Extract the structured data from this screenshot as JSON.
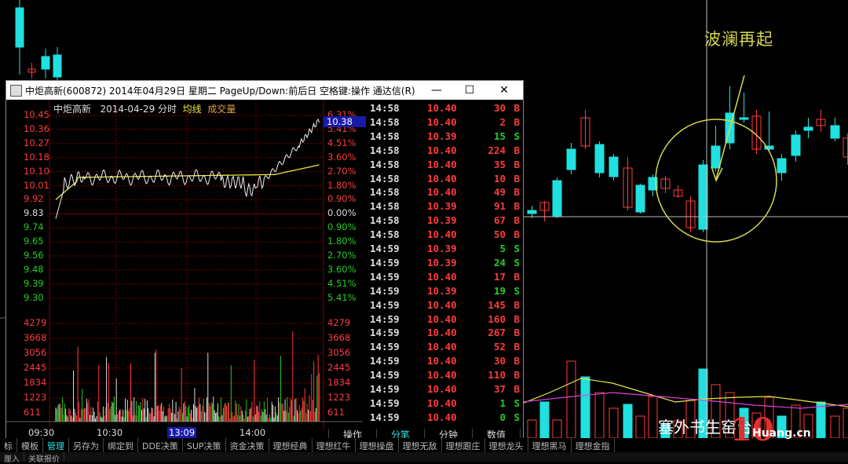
{
  "annotation": "波澜再起",
  "window": {
    "title": "中炬高新(600872) 2014年04月29日 星期二 PageUp/Down:前后日 空格键:操作 通达信(R)",
    "minimize": "—",
    "maximize": "☐",
    "close": "✕"
  },
  "chart_header": {
    "name": "中炬高新",
    "date": "2014-04-29 分时",
    "avg_label": "均线",
    "vol_label": "成交量"
  },
  "current_price_box": "10.38",
  "price_axis_left": [
    "10.45",
    "10.36",
    "10.27",
    "10.18",
    "10.10",
    "10.01",
    "9.92",
    "9.83",
    "9.74",
    "9.65",
    "9.56",
    "9.48",
    "9.39",
    "9.30"
  ],
  "pct_axis_right": [
    "6.31%",
    "5.41%",
    "4.51%",
    "3.60%",
    "2.70%",
    "1.80%",
    "0.90%",
    "0.00%",
    "0.90%",
    "1.80%",
    "2.70%",
    "3.60%",
    "4.51%",
    "5.41%"
  ],
  "volume_axis": [
    "4279",
    "3668",
    "3056",
    "2445",
    "1834",
    "1223",
    "611"
  ],
  "time_axis": [
    "09:30",
    "10:30",
    "13:09",
    "14:00"
  ],
  "chart_tabs": [
    "操作",
    "分笔",
    "分钟",
    "数值"
  ],
  "ticks": [
    {
      "time": "14:58",
      "price": "10.40",
      "vol": "30",
      "flag": "B"
    },
    {
      "time": "14:58",
      "price": "10.40",
      "vol": "2",
      "flag": "B"
    },
    {
      "time": "14:58",
      "price": "10.39",
      "vol": "15",
      "flag": "S"
    },
    {
      "time": "14:58",
      "price": "10.40",
      "vol": "224",
      "flag": "B"
    },
    {
      "time": "14:58",
      "price": "10.40",
      "vol": "35",
      "flag": "B"
    },
    {
      "time": "14:58",
      "price": "10.40",
      "vol": "10",
      "flag": "B"
    },
    {
      "time": "14:58",
      "price": "10.40",
      "vol": "49",
      "flag": "B"
    },
    {
      "time": "14:58",
      "price": "10.39",
      "vol": "91",
      "flag": "B"
    },
    {
      "time": "14:58",
      "price": "10.39",
      "vol": "67",
      "flag": "B"
    },
    {
      "time": "14:58",
      "price": "10.40",
      "vol": "50",
      "flag": "B"
    },
    {
      "time": "14:59",
      "price": "10.39",
      "vol": "5",
      "flag": "S"
    },
    {
      "time": "14:59",
      "price": "10.39",
      "vol": "24",
      "flag": "S"
    },
    {
      "time": "14:59",
      "price": "10.40",
      "vol": "17",
      "flag": "B"
    },
    {
      "time": "14:59",
      "price": "10.39",
      "vol": "19",
      "flag": "S"
    },
    {
      "time": "14:59",
      "price": "10.40",
      "vol": "145",
      "flag": "B"
    },
    {
      "time": "14:59",
      "price": "10.40",
      "vol": "160",
      "flag": "B"
    },
    {
      "time": "14:59",
      "price": "10.40",
      "vol": "267",
      "flag": "B"
    },
    {
      "time": "14:59",
      "price": "10.40",
      "vol": "52",
      "flag": "B"
    },
    {
      "time": "14:59",
      "price": "10.40",
      "vol": "30",
      "flag": "B"
    },
    {
      "time": "14:59",
      "price": "10.40",
      "vol": "110",
      "flag": "B"
    },
    {
      "time": "14:59",
      "price": "10.40",
      "vol": "37",
      "flag": "B"
    },
    {
      "time": "14:59",
      "price": "10.40",
      "vol": "1",
      "flag": "S"
    },
    {
      "time": "14:59",
      "price": "10.40",
      "vol": "0",
      "flag": "S"
    }
  ],
  "bottom_tabs": [
    "标",
    "模板",
    "管理",
    "另存为",
    "绑定到",
    "DDE决策",
    "SUP决策",
    "资金决策",
    "理想经典",
    "理想红牛",
    "理想操盘",
    "理想无敌",
    "理想跟庄",
    "理想龙头",
    "理想黑马",
    "理想金指"
  ],
  "status_items": [
    "厘入",
    "关联报价"
  ],
  "watermark": {
    "text": "塞外书生窑台",
    "site": "Huang.cn",
    "logo": "10"
  },
  "colors": {
    "up": "#ff3b3b",
    "down": "#20e0e0",
    "green": "#20d020",
    "avg": "#e8e840",
    "grid": "#7a0000"
  }
}
